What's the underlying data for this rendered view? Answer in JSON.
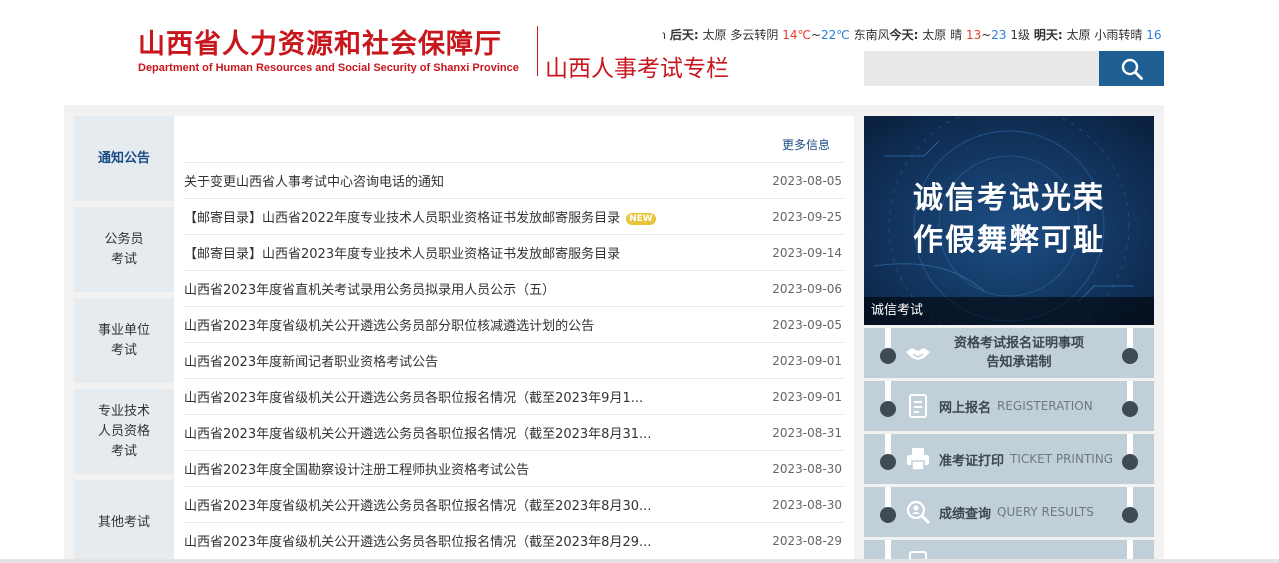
{
  "header": {
    "org_name_cn": "山西省人力资源和社会保障厅",
    "org_name_en": "Department of Human Resources and Social Security of Shanxi Province",
    "column_title": "山西人事考试专栏",
    "weather": {
      "lead": "℩",
      "day_after_label": "后天:",
      "day_after_city": "太原",
      "day_after_cond": "多云转阴",
      "day_after_high": "14℃",
      "day_after_sep": "~",
      "day_after_low": "22℃",
      "day_after_wind": "东南风",
      "today_label": "今天:",
      "today_city": "太原",
      "today_cond": "晴",
      "today_high": "13",
      "today_sep": "~",
      "today_low": "23",
      "today_wind": "1级",
      "tomorrow_label": "明天:",
      "tomorrow_city": "太原",
      "tomorrow_cond": "小雨转晴",
      "tomorrow_temp": "16"
    },
    "search": {
      "placeholder": "",
      "icon": "search-icon"
    }
  },
  "tabs": [
    {
      "label": "通知公告",
      "active": true
    },
    {
      "label": "公务员\n考试",
      "active": false
    },
    {
      "label": "事业单位\n考试",
      "active": false
    },
    {
      "label": "专业技术\n人员资格\n考试",
      "active": false
    },
    {
      "label": "其他考试",
      "active": false
    }
  ],
  "news": {
    "more_label": "更多信息",
    "items": [
      {
        "title": "关于变更山西省人事考试中心咨询电话的通知",
        "date": "2023-08-05",
        "is_new": false
      },
      {
        "title": "【邮寄目录】山西省2022年度专业技术人员职业资格证书发放邮寄服务目录",
        "date": "2023-09-25",
        "is_new": true,
        "badge": "NEW"
      },
      {
        "title": "【邮寄目录】山西省2023年度专业技术人员职业资格证书发放邮寄服务目录",
        "date": "2023-09-14",
        "is_new": false
      },
      {
        "title": "山西省2023年度省直机关考试录用公务员拟录用人员公示（五）",
        "date": "2023-09-06",
        "is_new": false
      },
      {
        "title": "山西省2023年度省级机关公开遴选公务员部分职位核减遴选计划的公告",
        "date": "2023-09-05",
        "is_new": false
      },
      {
        "title": "山西省2023年度新闻记者职业资格考试公告",
        "date": "2023-09-01",
        "is_new": false
      },
      {
        "title": "山西省2023年度省级机关公开遴选公务员各职位报名情况（截至2023年9月1...",
        "date": "2023-09-01",
        "is_new": false
      },
      {
        "title": "山西省2023年度省级机关公开遴选公务员各职位报名情况（截至2023年8月31...",
        "date": "2023-08-31",
        "is_new": false
      },
      {
        "title": "山西省2023年度全国勘察设计注册工程师执业资格考试公告",
        "date": "2023-08-30",
        "is_new": false
      },
      {
        "title": "山西省2023年度省级机关公开遴选公务员各职位报名情况（截至2023年8月30...",
        "date": "2023-08-30",
        "is_new": false
      },
      {
        "title": "山西省2023年度省级机关公开遴选公务员各职位报名情况（截至2023年8月29...",
        "date": "2023-08-29",
        "is_new": false
      }
    ]
  },
  "banner": {
    "line1": "诚信考试光荣",
    "line2": "作假舞弊可耻",
    "caption": "诚信考试"
  },
  "services": [
    {
      "cn_line1": "资格考试报名证明事项",
      "cn_line2": "告知承诺制",
      "en": "",
      "icon": "handshake-icon"
    },
    {
      "cn": "网上报名",
      "en": "REGISTERATION",
      "icon": "form-icon"
    },
    {
      "cn": "准考证打印",
      "en": "TICKET PRINTING",
      "icon": "printer-icon"
    },
    {
      "cn": "成绩查询",
      "en": "QUERY RESULTS",
      "icon": "search-person-icon"
    }
  ],
  "colors": {
    "brand_red": "#c8161d",
    "nav_blue": "#1c4e86",
    "search_blue": "#1f5f93",
    "service_bg": "#c1cfd9",
    "banner_bg": "#0e2b4c"
  }
}
